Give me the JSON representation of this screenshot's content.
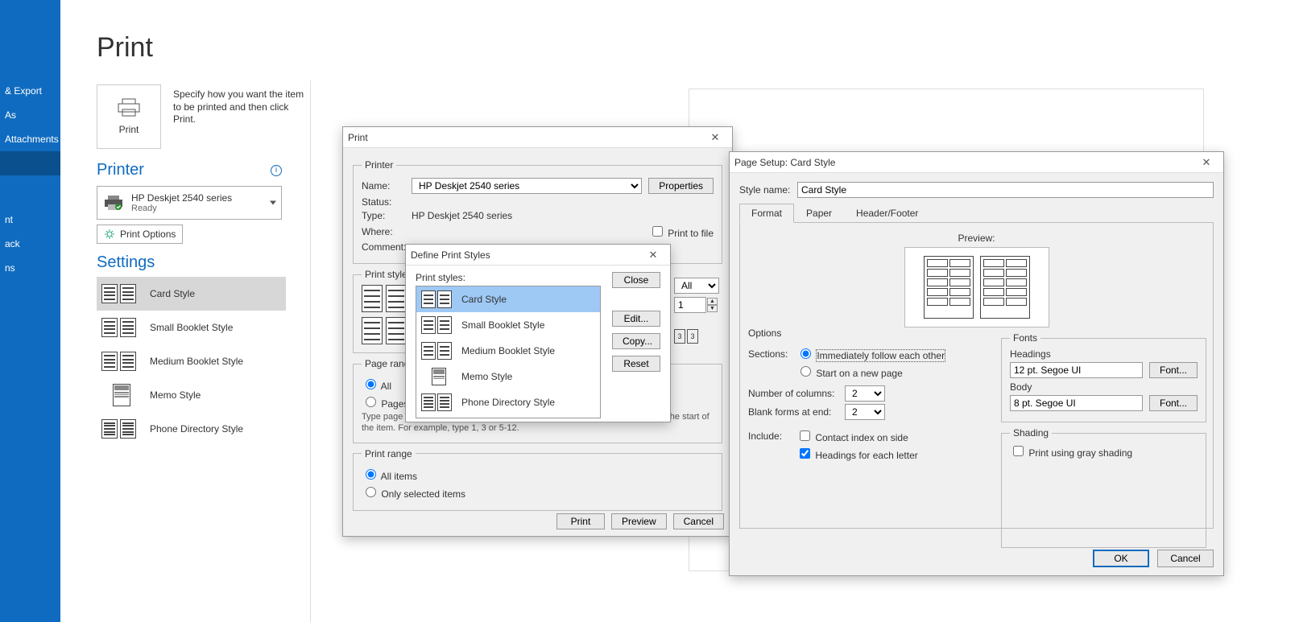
{
  "sidenav": {
    "items": [
      {
        "label": "& Export"
      },
      {
        "label": "As"
      },
      {
        "label": "Attachments"
      },
      {
        "label": ""
      },
      {
        "label": "nt"
      },
      {
        "label": "ack"
      },
      {
        "label": "ns"
      }
    ]
  },
  "page": {
    "title": "Print",
    "tile_label": "Print",
    "tile_desc": "Specify how you want the item to be printed and then click Print."
  },
  "printer": {
    "heading": "Printer",
    "name": "HP Deskjet 2540 series",
    "status": "Ready",
    "options_button": "Print Options"
  },
  "settings": {
    "heading": "Settings",
    "styles": [
      {
        "label": "Card Style",
        "selected": true
      },
      {
        "label": "Small Booklet Style",
        "selected": false
      },
      {
        "label": "Medium Booklet Style",
        "selected": false
      },
      {
        "label": "Memo Style",
        "selected": false
      },
      {
        "label": "Phone Directory Style",
        "selected": false
      }
    ]
  },
  "print_dialog": {
    "title": "Print",
    "printer_group": "Printer",
    "labels": {
      "name": "Name:",
      "status": "Status:",
      "type": "Type:",
      "where": "Where:",
      "comment": "Comment:"
    },
    "name_value": "HP Deskjet 2540 series",
    "type_value": "HP Deskjet 2540 series",
    "properties_btn": "Properties",
    "print_to_file": "Print to file",
    "print_style_group": "Print style",
    "copies_label_all": "All",
    "copies_value": "1",
    "page_options_number": "3",
    "page_range_group": "Page range",
    "page_range_all": "All",
    "page_range_pages": "Pages:",
    "page_range_help": "Type page numbers and/or page ranges separated by commas counting from the start of the item. For example, type 1, 3 or 5-12.",
    "print_range_group": "Print range",
    "print_range_all": "All items",
    "print_range_sel": "Only selected items",
    "buttons": {
      "print": "Print",
      "preview": "Preview",
      "cancel": "Cancel"
    }
  },
  "styles_dialog": {
    "title": "Define Print Styles",
    "list_label": "Print styles:",
    "items": [
      "Card Style",
      "Small Booklet Style",
      "Medium Booklet Style",
      "Memo Style",
      "Phone Directory Style"
    ],
    "buttons": {
      "close": "Close",
      "edit": "Edit...",
      "copy": "Copy...",
      "reset": "Reset"
    }
  },
  "setup_dialog": {
    "title": "Page Setup: Card Style",
    "style_name_label": "Style name:",
    "style_name_value": "Card Style",
    "tabs": [
      "Format",
      "Paper",
      "Header/Footer"
    ],
    "preview_label": "Preview:",
    "options_group": "Options",
    "sections_label": "Sections:",
    "sections_opt1": "Immediately follow each other",
    "sections_opt2": "Start on a new page",
    "num_cols_label": "Number of columns:",
    "num_cols_value": "2",
    "blank_forms_label": "Blank forms at end:",
    "blank_forms_value": "2",
    "include_label": "Include:",
    "include_opt1": "Contact index on side",
    "include_opt2": "Headings for each letter",
    "fonts_group": "Fonts",
    "headings_label": "Headings",
    "headings_value": "12 pt. Segoe UI",
    "body_label": "Body",
    "body_value": "8 pt. Segoe UI",
    "font_btn": "Font...",
    "shading_group": "Shading",
    "shading_opt": "Print using gray shading",
    "buttons": {
      "ok": "OK",
      "cancel": "Cancel"
    }
  }
}
